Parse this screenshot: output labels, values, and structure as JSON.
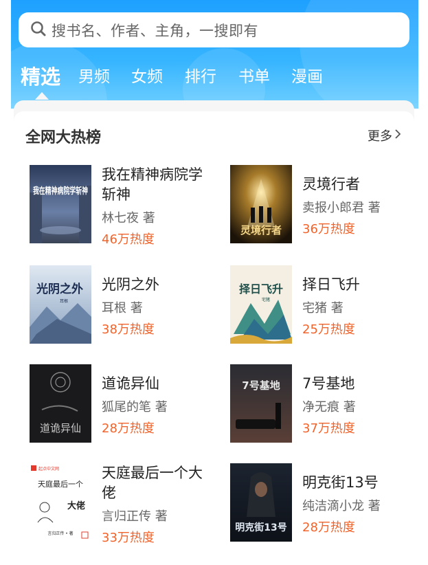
{
  "search": {
    "placeholder": "搜书名、作者、主角，一搜即有"
  },
  "tabs": [
    {
      "label": "精选",
      "active": true
    },
    {
      "label": "男频"
    },
    {
      "label": "女频"
    },
    {
      "label": "排行"
    },
    {
      "label": "书单"
    },
    {
      "label": "漫画"
    }
  ],
  "section": {
    "title": "全网大热榜",
    "more_label": "更多"
  },
  "books": [
    {
      "title": "我在精神病院学斩神",
      "author": "林七夜 著",
      "heat": "46万热度",
      "cover_text": "我在精神病院学斩神"
    },
    {
      "title": "灵境行者",
      "author": "卖报小郎君 著",
      "heat": "36万热度",
      "cover_text": "灵境行者"
    },
    {
      "title": "光阴之外",
      "author": "耳根  著",
      "heat": "38万热度",
      "cover_text": "光阴之外",
      "cover_sub": "耳根"
    },
    {
      "title": "择日飞升",
      "author": "宅猪 著",
      "heat": "25万热度",
      "cover_text": "择日飞升",
      "cover_sub": "宅猪"
    },
    {
      "title": "道诡异仙",
      "author": "狐尾的笔 著",
      "heat": "28万热度",
      "cover_text": "道诡异仙"
    },
    {
      "title": "7号基地",
      "author": "净无痕 著",
      "heat": "37万热度",
      "cover_text": "7号基地"
    },
    {
      "title": "天庭最后一个大佬",
      "author": "言归正传 著",
      "heat": "33万热度",
      "cover_text": "天庭最后一个",
      "cover_text2": "大佬",
      "cover_brand": "起点中文网",
      "cover_sub": "言归正传 • 著"
    },
    {
      "title": "明克街13号",
      "author": "纯洁滴小龙 著",
      "heat": "28万热度",
      "cover_text": "明克街13号"
    }
  ],
  "colors": {
    "header": "#1ea0ff",
    "heat": "#f0642c"
  }
}
